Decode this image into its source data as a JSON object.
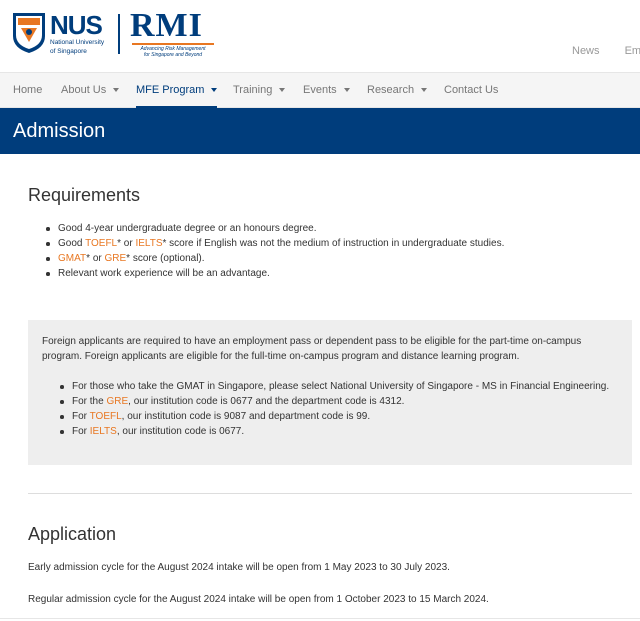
{
  "header": {
    "nus_logo": "NUS",
    "nus_subtitle_line1": "National University",
    "nus_subtitle_line2": "of Singapore",
    "rmi_logo": "RMI",
    "rmi_tagline_line1": "Advancing Risk Management",
    "rmi_tagline_line2": "for Singapore and Beyond",
    "top_links": [
      "News",
      "Ema"
    ]
  },
  "nav": {
    "items": [
      {
        "label": "Home",
        "dropdown": false
      },
      {
        "label": "About Us",
        "dropdown": true
      },
      {
        "label": "MFE Program",
        "dropdown": true,
        "active": true
      },
      {
        "label": "Training",
        "dropdown": true
      },
      {
        "label": "Events",
        "dropdown": true
      },
      {
        "label": "Research",
        "dropdown": true
      },
      {
        "label": "Contact Us",
        "dropdown": false
      }
    ]
  },
  "page_title": "Admission",
  "requirements": {
    "heading": "Requirements",
    "item1": "Good 4-year undergraduate degree or an honours degree.",
    "item2_pre": "Good ",
    "item2_link1": "TOEFL",
    "item2_mid": "* or ",
    "item2_link2": "IELTS",
    "item2_post": "* score if English was not the medium of instruction in undergraduate studies.",
    "item3_link1": "GMAT",
    "item3_mid": "* or ",
    "item3_link2": "GRE",
    "item3_post": "* score (optional).",
    "item4": "Relevant work experience will be an advantage."
  },
  "foreign": {
    "paragraph": "Foreign applicants are required to have an employment pass or dependent pass to be eligible for the part-time on-campus program. Foreign applicants are eligible for the full-time on-campus program and distance learning program.",
    "item1": "For those who take the GMAT in Singapore, please select National University of Singapore - MS in Financial Engineering.",
    "item2_pre": "For the ",
    "item2_link": "GRE",
    "item2_post": ", our institution code is 0677 and the department code is 4312.",
    "item3_pre": "For ",
    "item3_link": "TOEFL",
    "item3_post": ", our institution code is 9087 and department code is 99.",
    "item4_pre": "For ",
    "item4_link": "IELTS",
    "item4_post": ", our institution code is 0677."
  },
  "application": {
    "heading": "Application",
    "early": "Early admission cycle for the August 2024 intake will be open from 1 May 2023 to 30 July 2023.",
    "regular": "Regular admission cycle for the August 2024 intake will be open from 1 October 2023 to 15 March 2024."
  },
  "colors": {
    "brand_blue": "#003d7c",
    "accent_orange": "#e87722"
  }
}
